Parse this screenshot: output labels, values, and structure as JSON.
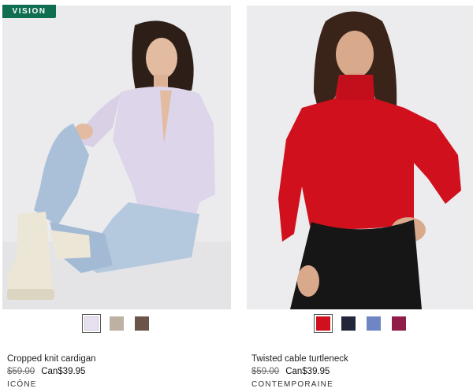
{
  "products": [
    {
      "badge": "VISION",
      "name": "Cropped knit cardigan",
      "old_price": "$59.00",
      "price": "Can$39.95",
      "brand": "ICÔNE",
      "swatches": [
        {
          "color": "#e6e0ef",
          "selected": true
        },
        {
          "color": "#bdb1a3",
          "selected": false
        },
        {
          "color": "#6b5448",
          "selected": false
        }
      ]
    },
    {
      "name": "Twisted cable turtleneck",
      "old_price": "$59.00",
      "price": "Can$39.95",
      "brand": "CONTEMPORAINE",
      "swatches": [
        {
          "color": "#d0111d",
          "selected": true
        },
        {
          "color": "#23263a",
          "selected": false
        },
        {
          "color": "#6f86c4",
          "selected": false
        },
        {
          "color": "#8e1d4a",
          "selected": false
        }
      ]
    }
  ]
}
